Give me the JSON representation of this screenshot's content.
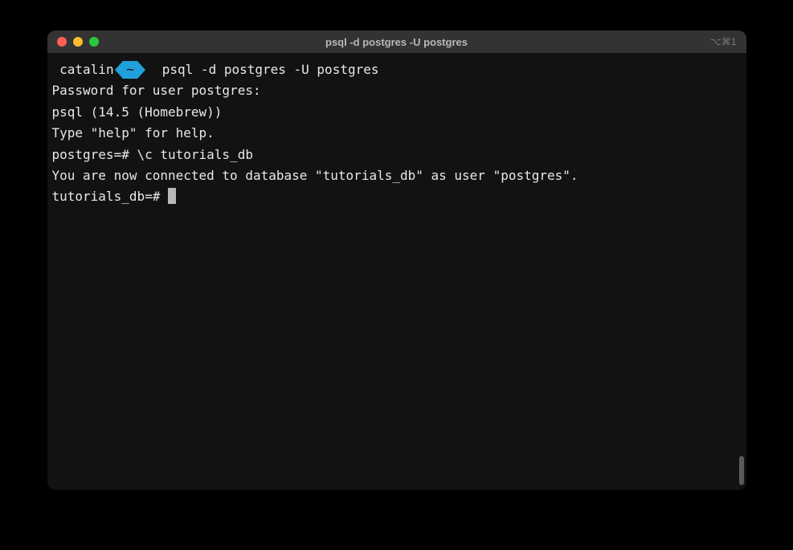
{
  "window": {
    "title": "psql -d postgres -U postgres",
    "shortcut": "⌥⌘1"
  },
  "prompt": {
    "user": "catalin",
    "dir": "~",
    "command": "psql -d postgres -U postgres"
  },
  "output": {
    "line1": "Password for user postgres:",
    "line2": "psql (14.5 (Homebrew))",
    "line3": "Type \"help\" for help.",
    "blank": "",
    "line4": "postgres=# \\c tutorials_db",
    "line5": "You are now connected to database \"tutorials_db\" as user \"postgres\".",
    "line6": "tutorials_db=# "
  }
}
